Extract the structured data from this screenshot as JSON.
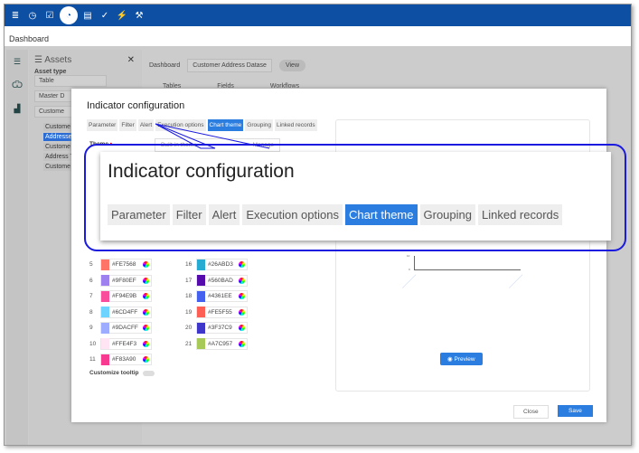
{
  "topbar": {
    "icons": [
      "database-icon",
      "clock-icon",
      "checkbox-icon",
      "gauge-icon",
      "document-icon",
      "check-edit-icon",
      "plug-icon",
      "wrench-icon"
    ],
    "active": 3,
    "color": "#0d4fa3"
  },
  "header": {
    "title": "Dashboard"
  },
  "assets": {
    "title": "Assets",
    "asset_type_label": "Asset type",
    "asset_type_value": "Table",
    "filters": [
      "Master D",
      "Custome"
    ],
    "items": [
      "Custome",
      "Addresses",
      "Custome",
      "Address T",
      "Custome"
    ],
    "selected": 1
  },
  "main": {
    "dashboard_label": "Dashboard",
    "dataset": "Customer Address Datase",
    "view": "View",
    "columns": [
      "Tables",
      "Fields",
      "Workflows"
    ]
  },
  "dialog": {
    "title": "Indicator configuration",
    "tabs": [
      "Parameter",
      "Filter",
      "Alert",
      "Execution options",
      "Chart theme",
      "Grouping",
      "Linked records"
    ],
    "active_tab": 4,
    "theme_label": "Theme",
    "theme_value": "Built-in theme",
    "manage": "Manage",
    "colors_left": [
      {
        "n": "5",
        "hex": "#FE7568"
      },
      {
        "n": "6",
        "hex": "#9F80EF"
      },
      {
        "n": "7",
        "hex": "#F94E9B"
      },
      {
        "n": "8",
        "hex": "#6CD4FF"
      },
      {
        "n": "9",
        "hex": "#9DACFF"
      },
      {
        "n": "10",
        "hex": "#FFE4F3"
      },
      {
        "n": "11",
        "hex": "#F83A90"
      }
    ],
    "colors_right": [
      {
        "n": "16",
        "hex": "#26ABD3"
      },
      {
        "n": "17",
        "hex": "#560BAD"
      },
      {
        "n": "18",
        "hex": "#4361EE"
      },
      {
        "n": "19",
        "hex": "#FE5F55"
      },
      {
        "n": "20",
        "hex": "#3F37C9"
      },
      {
        "n": "21",
        "hex": "#A7C957"
      }
    ],
    "customize_tooltip": "Customize tooltip",
    "customize_tooltip_on": false,
    "preview": "Preview",
    "close": "Close",
    "save": "Save",
    "accent": "#2b7de0"
  },
  "callout": {
    "title": "Indicator configuration",
    "tabs": [
      "Parameter",
      "Filter",
      "Alert",
      "Execution options",
      "Chart theme",
      "Grouping",
      "Linked records"
    ],
    "active_tab": 4
  }
}
